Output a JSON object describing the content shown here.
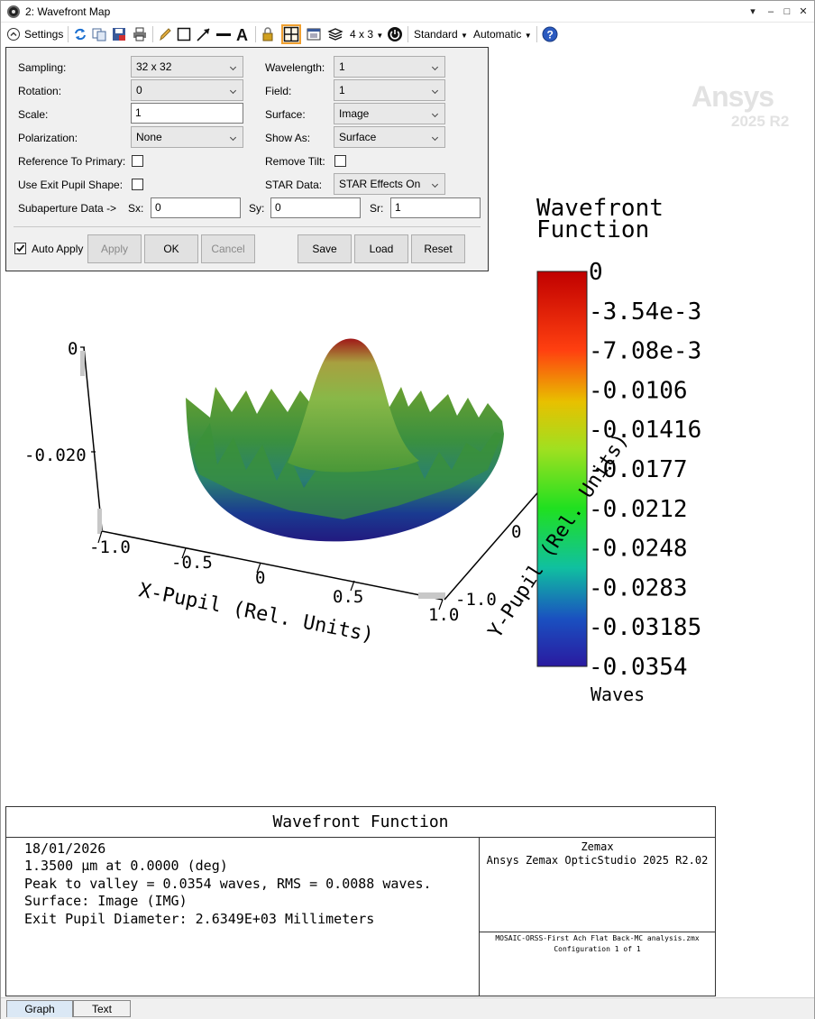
{
  "window": {
    "title": "2: Wavefront Map",
    "controls": [
      "▾",
      "–",
      "□",
      "✕"
    ]
  },
  "toolbar": {
    "settings_label": "Settings",
    "layout_label": "4 x 3",
    "standard_label": "Standard",
    "automatic_label": "Automatic"
  },
  "settings": {
    "sampling_label": "Sampling:",
    "sampling_value": "32 x 32",
    "rotation_label": "Rotation:",
    "rotation_value": "0",
    "scale_label": "Scale:",
    "scale_value": "1",
    "polarization_label": "Polarization:",
    "polarization_value": "None",
    "ref_primary_label": "Reference To Primary:",
    "exit_pupil_label": "Use Exit Pupil Shape:",
    "wavelength_label": "Wavelength:",
    "wavelength_value": "1",
    "field_label": "Field:",
    "field_value": "1",
    "surface_label": "Surface:",
    "surface_value": "Image",
    "show_as_label": "Show As:",
    "show_as_value": "Surface",
    "remove_tilt_label": "Remove Tilt:",
    "star_label": "STAR Data:",
    "star_value": "STAR Effects On",
    "subaperture_label": "Subaperture Data ->",
    "sx_label": "Sx:",
    "sx_value": "0",
    "sy_label": "Sy:",
    "sy_value": "0",
    "sr_label": "Sr:",
    "sr_value": "1",
    "auto_apply_label": "Auto Apply",
    "auto_apply_checked": true,
    "buttons": {
      "apply": "Apply",
      "ok": "OK",
      "cancel": "Cancel",
      "save": "Save",
      "load": "Load",
      "reset": "Reset"
    }
  },
  "watermark": {
    "brand": "Ansys",
    "version": "2025 R2"
  },
  "plot": {
    "colorbar_title_1": "Wavefront",
    "colorbar_title_2": "Function",
    "colorbar_labels": [
      "0",
      "-3.54e-3",
      "-7.08e-3",
      "-0.0106",
      "-0.01416",
      "-0.0177",
      "-0.0212",
      "-0.0248",
      "-0.0283",
      "-0.03185",
      "-0.0354"
    ],
    "colorbar_unit": "Waves",
    "z_ticks": [
      "0",
      "-0.020"
    ],
    "x_ticks": [
      "-1.0",
      "-0.5",
      "0",
      "0.5",
      "1.0"
    ],
    "x_label": "X-Pupil (Rel. Units)",
    "y_ticks": [
      "-1.0",
      "0"
    ],
    "y_label": "Y-Pupil (Rel. Units)"
  },
  "info": {
    "title": "Wavefront Function",
    "lines": [
      "18/01/2026",
      "1.3500 µm at 0.0000 (deg)",
      "Peak to valley = 0.0354 waves, RMS = 0.0088 waves.",
      "Surface: Image (IMG)",
      "Exit Pupil Diameter: 2.6349E+03 Millimeters"
    ],
    "company": "Zemax",
    "product": "Ansys Zemax OpticStudio 2025 R2.02",
    "file": "MOSAIC-ORSS-First Ach Flat Back-MC analysis.zmx",
    "config": "Configuration 1 of 1"
  },
  "tabs": {
    "graph": "Graph",
    "text": "Text"
  },
  "colors": {
    "accent": "#f0a030",
    "bar_top": "#c00000",
    "bar_bottom": "#2a1aa0"
  }
}
